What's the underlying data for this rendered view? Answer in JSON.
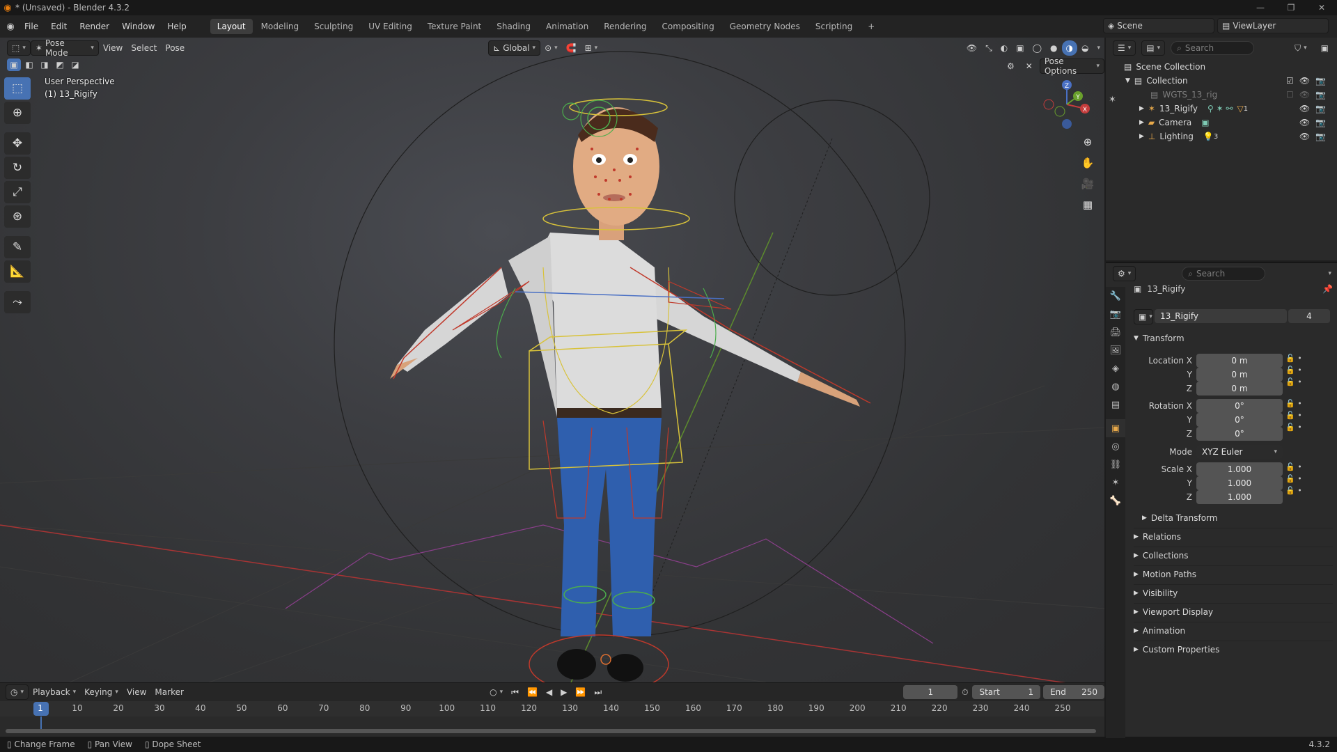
{
  "titlebar": {
    "title": "* (Unsaved) - Blender 4.3.2"
  },
  "menu": [
    "File",
    "Edit",
    "Render",
    "Window",
    "Help"
  ],
  "workspaces": [
    "Layout",
    "Modeling",
    "Sculpting",
    "UV Editing",
    "Texture Paint",
    "Shading",
    "Animation",
    "Rendering",
    "Compositing",
    "Geometry Nodes",
    "Scripting"
  ],
  "active_workspace": "Layout",
  "scene": {
    "name": "Scene",
    "view_layer": "ViewLayer"
  },
  "viewport": {
    "mode": "Pose Mode",
    "menus": [
      "View",
      "Select",
      "Pose"
    ],
    "orientation": "Global",
    "pose_options": "Pose Options",
    "overlay_line1": "User Perspective",
    "overlay_line2": "(1) 13_Rigify",
    "gizmo": {
      "x": "X",
      "y": "Y",
      "z": "Z"
    }
  },
  "outliner": {
    "search_placeholder": "Search",
    "root": "Scene Collection",
    "collection": "Collection",
    "items": [
      "WGTS_13_rig",
      "13_Rigify",
      "Camera",
      "Lighting"
    ],
    "rigify_badge": "1",
    "lighting_badge": "3"
  },
  "properties": {
    "search_placeholder": "Search",
    "object_name": "13_Rigify",
    "datablock_name": "13_Rigify",
    "user_count": "4",
    "transform": {
      "header": "Transform",
      "location_label": "Location X",
      "rotation_label": "Rotation X",
      "scale_label": "Scale X",
      "y_label": "Y",
      "z_label": "Z",
      "location": [
        "0 m",
        "0 m",
        "0 m"
      ],
      "rotation": [
        "0°",
        "0°",
        "0°"
      ],
      "mode_label": "Mode",
      "mode": "XYZ Euler",
      "scale": [
        "1.000",
        "1.000",
        "1.000"
      ],
      "delta": "Delta Transform"
    },
    "sections": [
      "Relations",
      "Collections",
      "Motion Paths",
      "Visibility",
      "Viewport Display",
      "Animation",
      "Custom Properties"
    ]
  },
  "timeline": {
    "menus": [
      "Playback",
      "Keying",
      "View",
      "Marker"
    ],
    "current_frame": "1",
    "start_label": "Start",
    "start": "1",
    "end_label": "End",
    "end": "250",
    "ticks": [
      "1",
      "10",
      "20",
      "30",
      "40",
      "50",
      "60",
      "70",
      "80",
      "90",
      "100",
      "110",
      "120",
      "130",
      "140",
      "150",
      "160",
      "170",
      "180",
      "190",
      "200",
      "210",
      "220",
      "230",
      "240",
      "250"
    ]
  },
  "statusbar": {
    "items": [
      "Change Frame",
      "Pan View",
      "Dope Sheet"
    ],
    "version": "4.3.2"
  },
  "colors": {
    "accent": "#4772b3",
    "orange": "#e8a94a",
    "bone_yellow": "#d8c23a",
    "bone_red": "#c0392b",
    "bone_green": "#4cae4c",
    "shirt": "#d9d9d9",
    "jeans": "#2f5fae"
  }
}
